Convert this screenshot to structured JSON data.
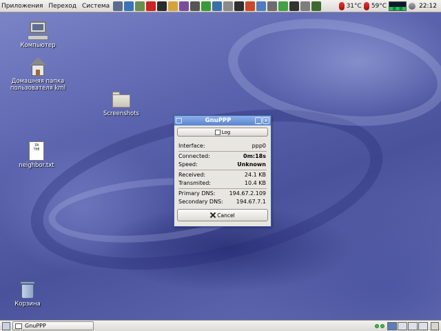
{
  "top_panel": {
    "menus": [
      "Приложения",
      "Переход",
      "Система"
    ],
    "launcher_colors": [
      "#5b6c8e",
      "#3b73b9",
      "#6b8e4e",
      "#cc2222",
      "#2b2b2b",
      "#d6a23c",
      "#7a4d99",
      "#555555",
      "#3a9a3a",
      "#3c6fa8",
      "#8a8a8a",
      "#2f2f2f",
      "#c74b2b",
      "#4e7cbf",
      "#6d6d6d",
      "#45a045",
      "#333333",
      "#7d7d7d",
      "#3f6a2e"
    ],
    "temp_cpu": "31°C",
    "temp_hdd": "59°C",
    "clock": "22:12"
  },
  "desktop_icons": {
    "computer": "Компьютер",
    "home_line1": "Домашняя папка",
    "home_line2": "пользователя kml",
    "screenshots": "Screenshots",
    "neighbor": "neighbor.txt",
    "neighbor_preview": "IN THE",
    "trash": "Корзина"
  },
  "window": {
    "title": "GnuPPP",
    "log_button": "Log",
    "interface_label": "Interface:",
    "interface_value": "ppp0",
    "connected_label": "Connected:",
    "connected_value": "0m:18s",
    "speed_label": "Speed:",
    "speed_value": "Unknown",
    "received_label": "Received:",
    "received_value": "24.1 KB",
    "transmitted_label": "Transmited:",
    "transmitted_value": "10.4 KB",
    "primary_dns_label": "Primary DNS:",
    "primary_dns_value": "194.67.2.109",
    "secondary_dns_label": "Secondary DNS:",
    "secondary_dns_value": "194.67.7.1",
    "cancel_button": "Cancel"
  },
  "bottom_panel": {
    "task": "GnuPPP"
  }
}
